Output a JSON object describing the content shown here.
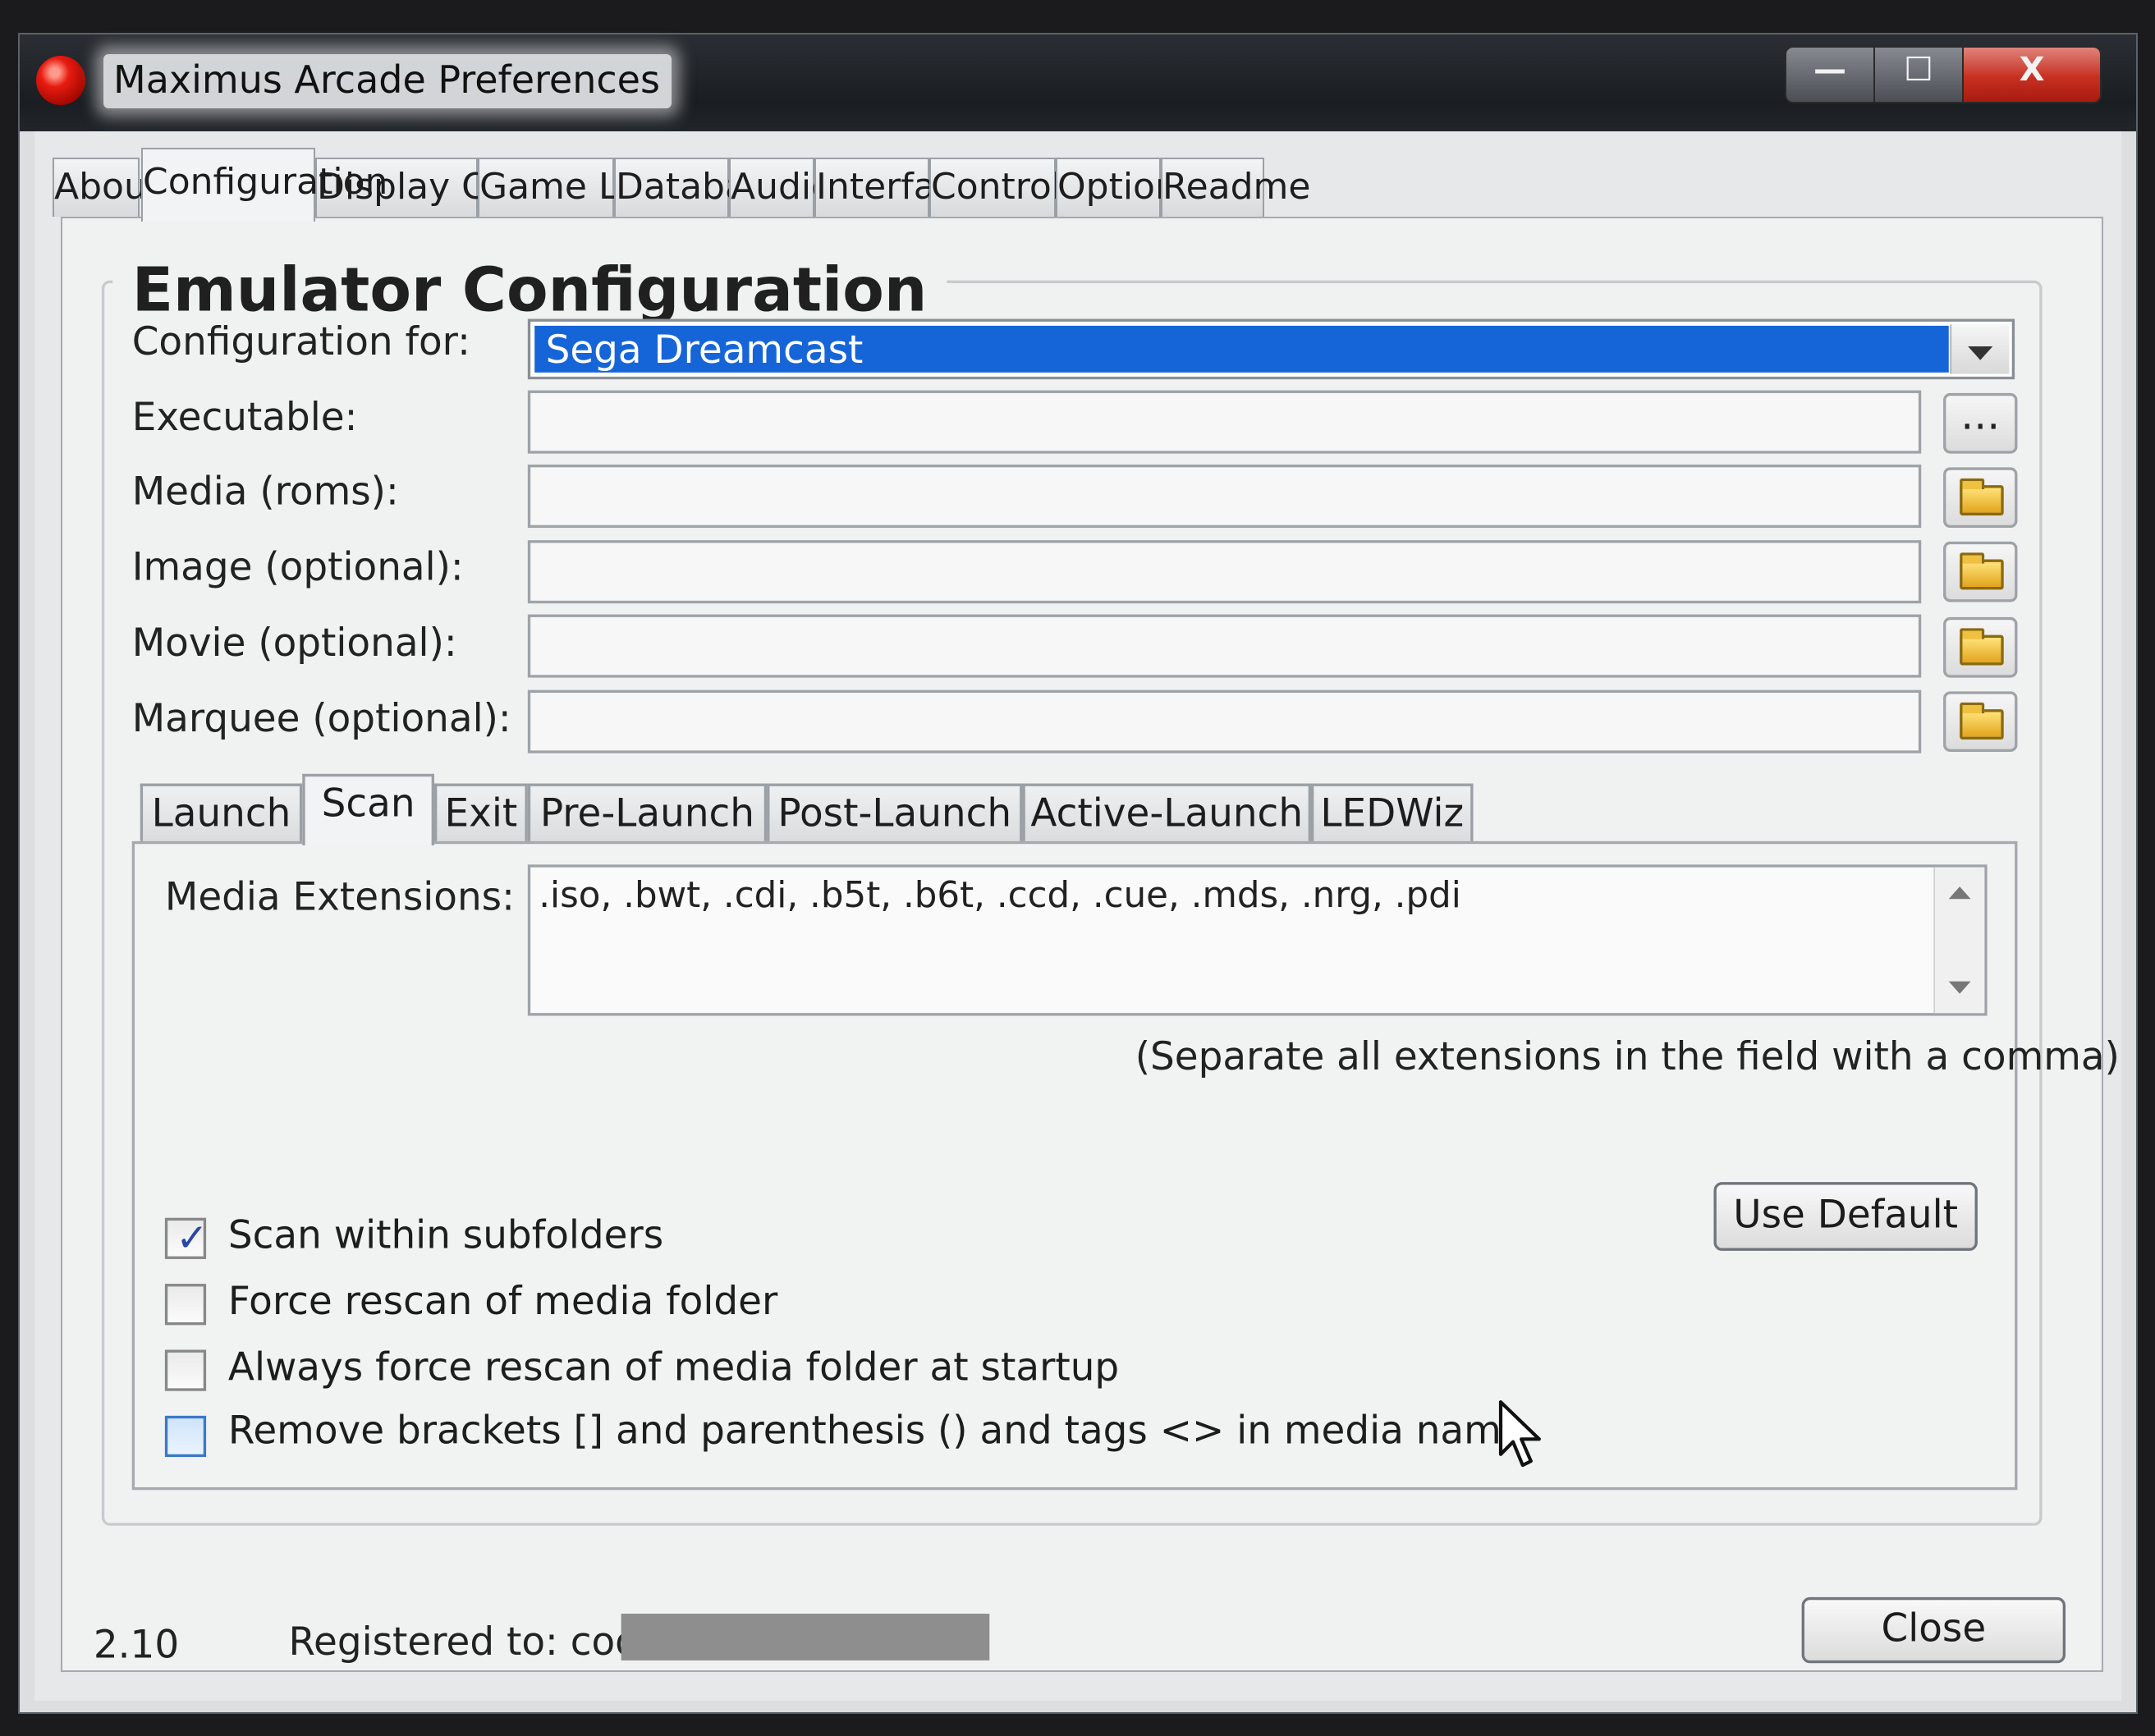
{
  "window": {
    "title": "Maximus Arcade Preferences",
    "controls": {
      "minimize": "—",
      "maximize": "☐",
      "close": "X"
    }
  },
  "tabs": [
    {
      "label": "About"
    },
    {
      "label": "Configuration",
      "active": true
    },
    {
      "label": "Display Order"
    },
    {
      "label": "Game Lists"
    },
    {
      "label": "Database"
    },
    {
      "label": "Audio"
    },
    {
      "label": "Interface"
    },
    {
      "label": "Controller"
    },
    {
      "label": "Options"
    },
    {
      "label": "Readme"
    }
  ],
  "emulator": {
    "group_title": "Emulator Configuration",
    "config_for_label": "Configuration for:",
    "config_for_value": "Sega Dreamcast",
    "fields": [
      {
        "label": "Executable:",
        "value": "",
        "button": "..."
      },
      {
        "label": "Media (roms):",
        "value": "",
        "button_icon": "folder-icon"
      },
      {
        "label": "Image (optional):",
        "value": "",
        "button_icon": "folder-icon"
      },
      {
        "label": "Movie (optional):",
        "value": "",
        "button_icon": "folder-icon"
      },
      {
        "label": "Marquee (optional):",
        "value": "",
        "button_icon": "folder-icon"
      }
    ]
  },
  "subtabs": [
    {
      "label": "Launch"
    },
    {
      "label": "Scan",
      "active": true
    },
    {
      "label": "Exit"
    },
    {
      "label": "Pre-Launch"
    },
    {
      "label": "Post-Launch"
    },
    {
      "label": "Active-Launch"
    },
    {
      "label": "LEDWiz"
    }
  ],
  "scan": {
    "media_ext_label": "Media Extensions:",
    "media_ext_value": ".iso, .bwt, .cdi, .b5t, .b6t, .ccd, .cue, .mds, .nrg, .pdi",
    "hint": "(Separate all extensions in the field with a comma)",
    "use_default": "Use Default",
    "checkboxes": [
      {
        "label": "Scan within subfolders",
        "checked": true
      },
      {
        "label": "Force rescan of media folder",
        "checked": false
      },
      {
        "label": "Always force rescan of media folder at startup",
        "checked": false
      },
      {
        "label": "Remove brackets [] and parenthesis () and tags <> in media name",
        "checked": false
      }
    ]
  },
  "footer": {
    "version": "2.10",
    "registered": "Registered to: code",
    "close": "Close"
  },
  "colors": {
    "selection": "#1665d8",
    "close_button": "#c63021"
  }
}
